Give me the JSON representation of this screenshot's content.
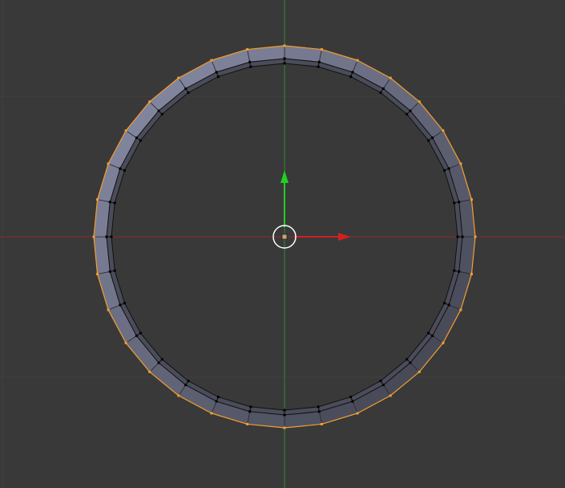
{
  "viewport": {
    "background": "#393939",
    "x_axis_color": "#c81e1e",
    "y_axis_color": "#1ec81e",
    "selection_color": "#f5a030",
    "mesh": {
      "type": "ring",
      "segments": 32,
      "selected_outer_vertices": true
    }
  }
}
